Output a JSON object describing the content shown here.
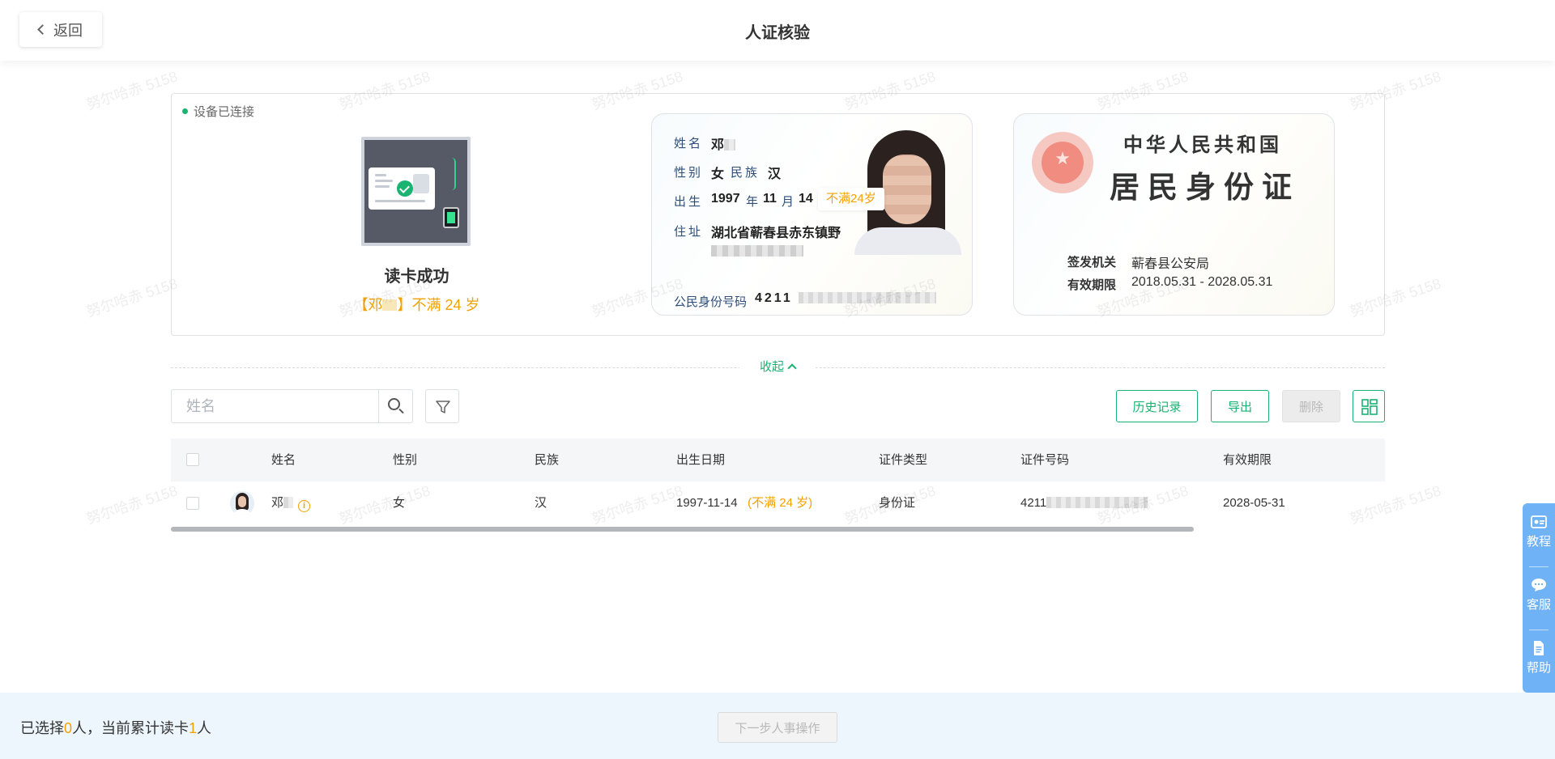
{
  "header": {
    "back_label": "返回",
    "title": "人证核验"
  },
  "watermark_text": "努尔哈赤 5158",
  "reader": {
    "device_status": "设备已连接",
    "read_result": "读卡成功",
    "note_prefix": "【邓",
    "note_suffix": "】不满 24 岁"
  },
  "id_front": {
    "name_label": "姓名",
    "name_value": "邓",
    "gender_label": "性别",
    "gender_value": "女",
    "ethnicity_label": "民族",
    "ethnicity_value": "汉",
    "birth_label": "出生",
    "birth_year": "1997",
    "year_unit": "年",
    "birth_month": "11",
    "month_unit": "月",
    "birth_day": "14",
    "age_tag": "不满24岁",
    "address_label": "住址",
    "address_value": "湖北省蕲春县赤东镇野",
    "id_number_label": "公民身份号码",
    "id_number_prefix": "4211"
  },
  "id_back": {
    "country_title": "中华人民共和国",
    "card_title": "居民身份证",
    "issuer_label": "签发机关",
    "issuer_value": "蕲春县公安局",
    "validity_label": "有效期限",
    "validity_value": "2018.05.31 - 2028.05.31"
  },
  "collapse_label": "收起",
  "toolbar": {
    "search_placeholder": "姓名",
    "history_label": "历史记录",
    "export_label": "导出",
    "delete_label": "删除"
  },
  "table": {
    "columns": [
      "姓名",
      "性别",
      "民族",
      "出生日期",
      "证件类型",
      "证件号码",
      "有效期限"
    ],
    "rows": [
      {
        "name": "邓",
        "gender": "女",
        "ethnicity": "汉",
        "birth_date": "1997-11-14",
        "age_note": "(不满 24 岁)",
        "id_type": "身份证",
        "id_number_prefix": "4211",
        "expiry": "2028-05-31"
      }
    ]
  },
  "float_tools": {
    "tutorial": "教程",
    "service": "客服",
    "help": "帮助"
  },
  "bottom": {
    "selected_prefix": "已选择",
    "selected_count": "0",
    "selected_mid": "人，当前累计读卡",
    "total_count": "1",
    "selected_suffix": "人",
    "next_label": "下一步人事操作"
  },
  "colors": {
    "accent_green": "#19b372",
    "warning_orange": "#f5a100",
    "float_blue": "#6fb2f5"
  }
}
